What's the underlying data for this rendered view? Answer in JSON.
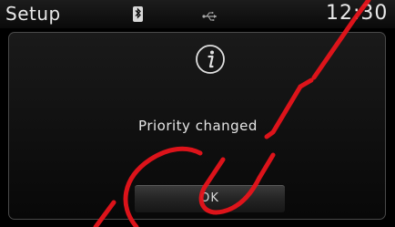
{
  "status_bar": {
    "title": "Setup",
    "time": "12:30",
    "icons": [
      "bluetooth-icon",
      "usb-icon"
    ]
  },
  "dialog": {
    "icon": "info-icon",
    "message": "Priority changed",
    "ok_label": "OK"
  },
  "watermark": {
    "text": "CU1",
    "color": "#e8141b"
  },
  "colors": {
    "background": "#000000",
    "text": "#e6e6e6",
    "dialog_border": "#4a4a4a"
  }
}
